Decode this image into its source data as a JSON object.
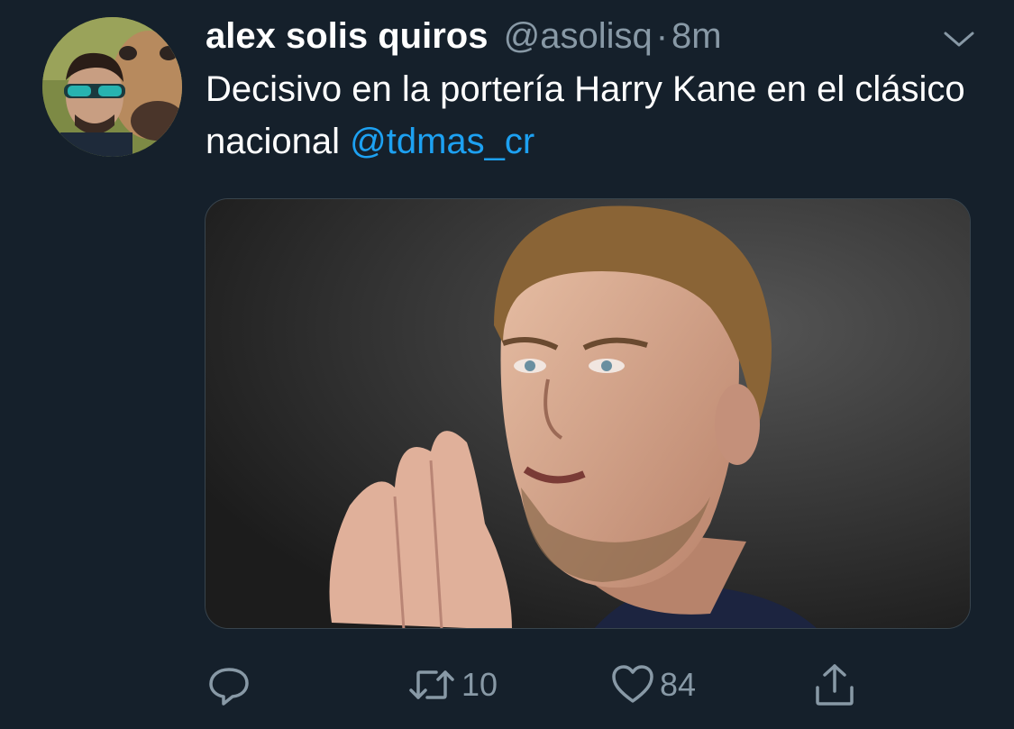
{
  "tweet": {
    "author_name": "alex solis quiros",
    "author_handle": "@asolisq",
    "separator": "·",
    "time": "8m",
    "text_before_mention": "Decisivo en la portería Harry Kane en el clásico nacional ",
    "mention": "@tdmas_cr",
    "image_icon": "photo-of-man-clapping",
    "avatar_icon": "profile-photo-with-cow"
  },
  "actions": {
    "reply_icon": "reply-icon",
    "retweet_icon": "retweet-icon",
    "retweet_count": "10",
    "like_icon": "heart-icon",
    "like_count": "84",
    "share_icon": "share-icon"
  },
  "colors": {
    "background": "#15202b",
    "primary_text": "#ffffff",
    "secondary_text": "#8899a6",
    "link": "#1da1f2"
  }
}
